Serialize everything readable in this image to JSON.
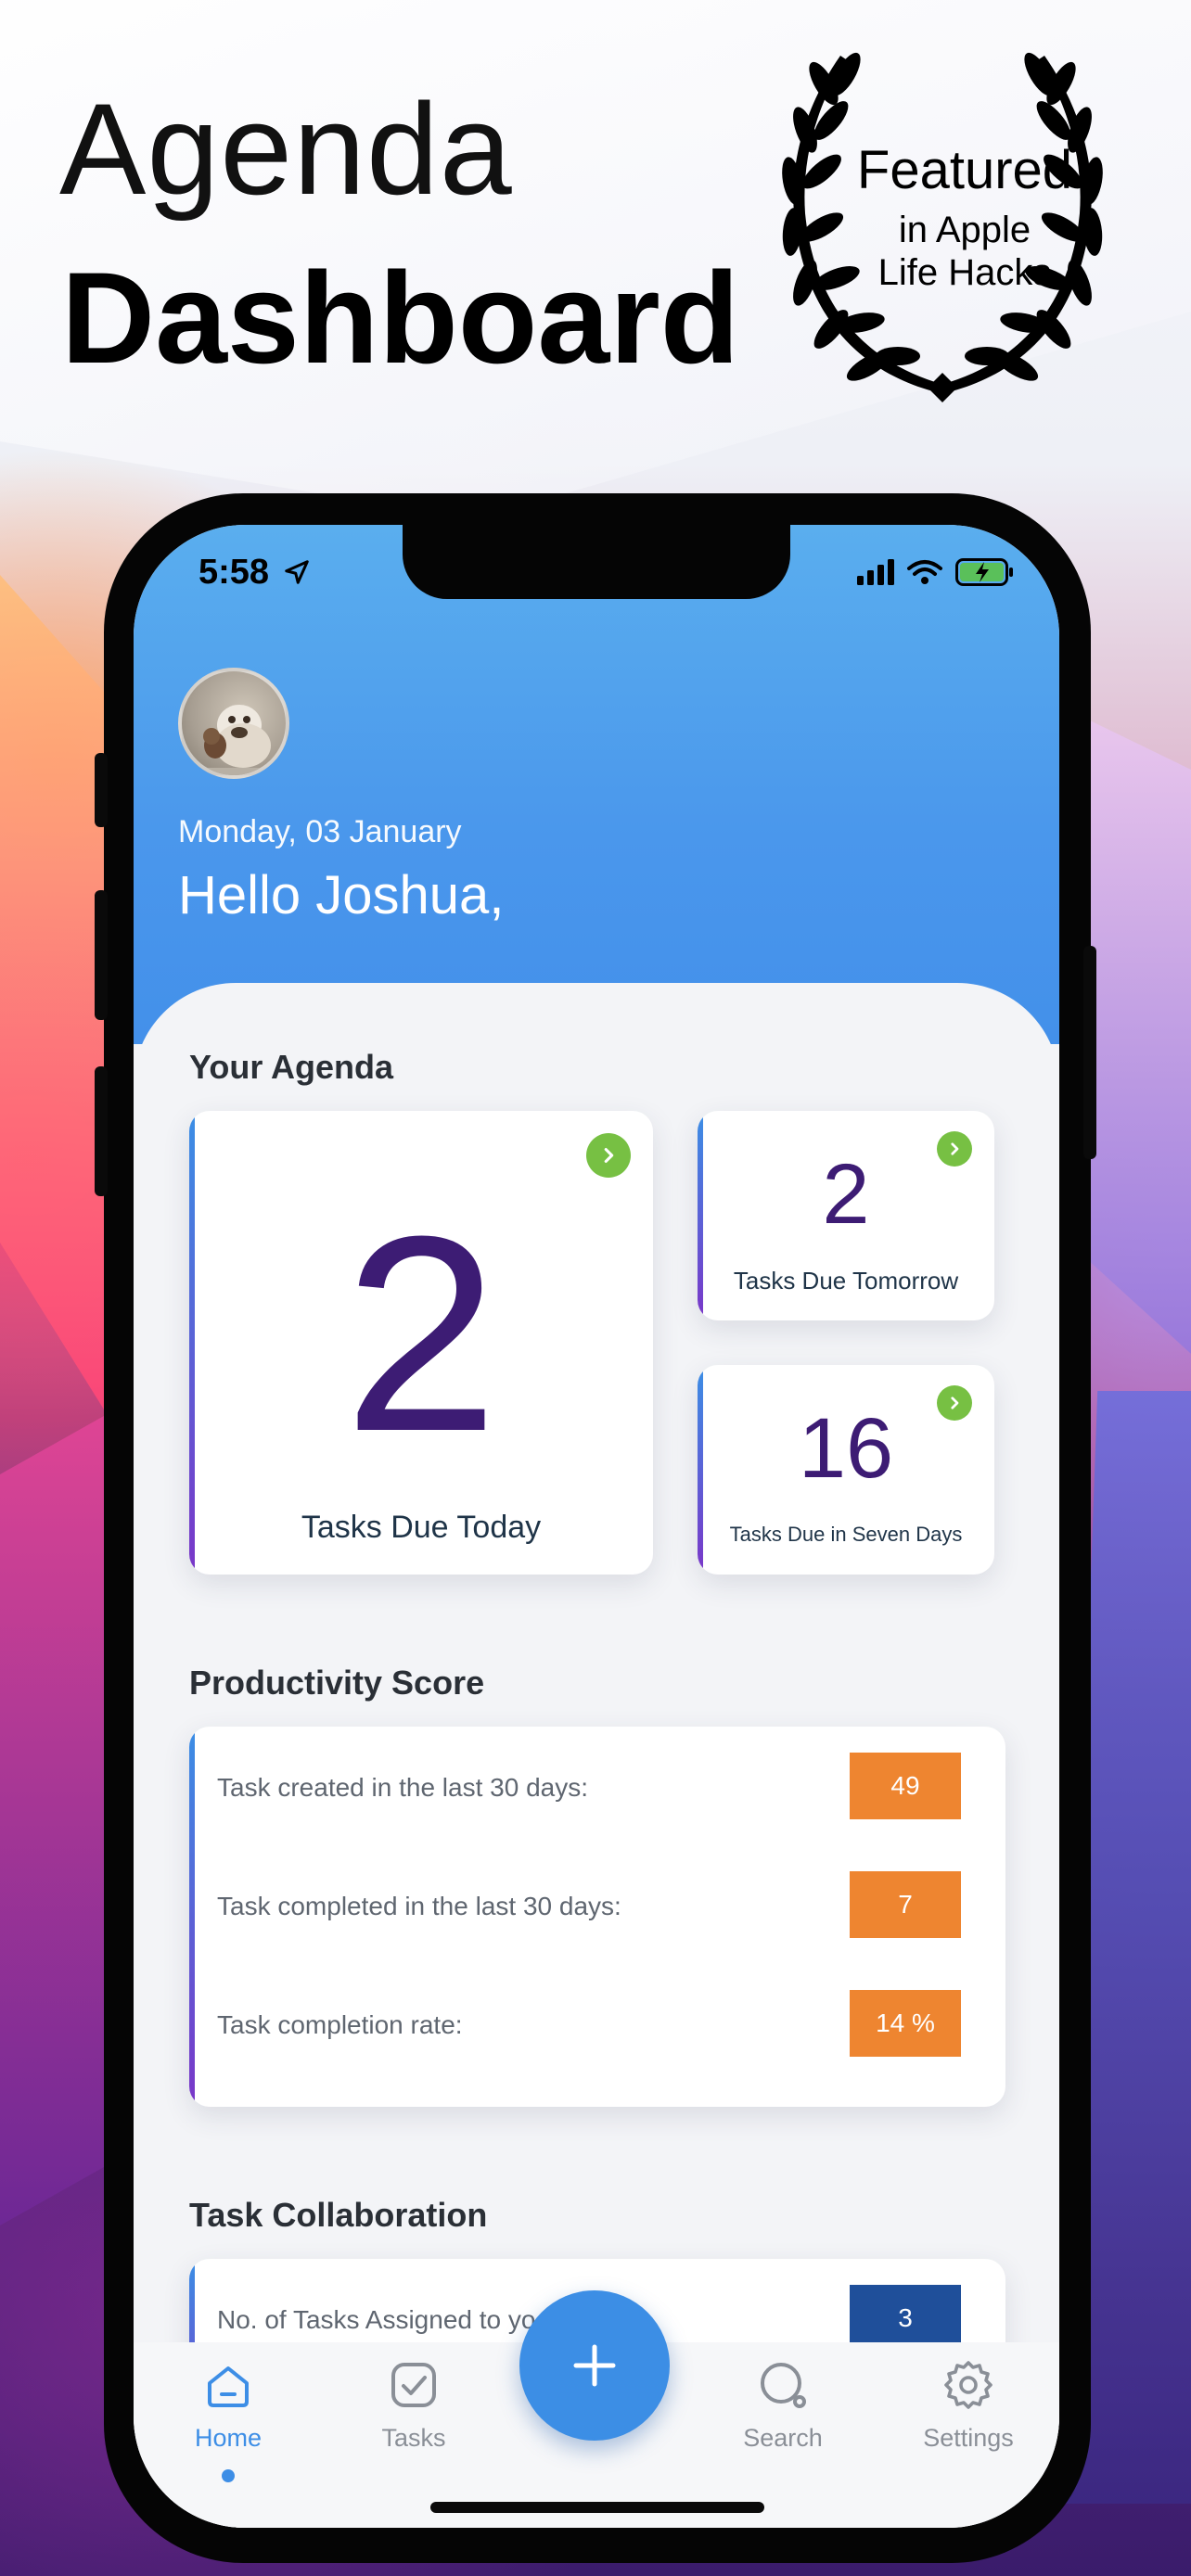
{
  "promo": {
    "title_line1": "Agenda",
    "title_line2": "Dashboard",
    "award_line1": "Featured",
    "award_line2": "in Apple",
    "award_line3": "Life Hacks"
  },
  "status_bar": {
    "time": "5:58",
    "icons": [
      "location-arrow-icon",
      "cellular-signal-icon",
      "wifi-icon",
      "battery-charging-icon"
    ]
  },
  "header": {
    "date": "Monday, 03 January",
    "greeting": "Hello Joshua,"
  },
  "agenda": {
    "title": "Your Agenda",
    "today": {
      "count": "2",
      "label": "Tasks Due Today"
    },
    "tomorrow": {
      "count": "2",
      "label": "Tasks Due Tomorrow"
    },
    "seven_days": {
      "count": "16",
      "label": "Tasks Due in Seven Days"
    }
  },
  "productivity": {
    "title": "Productivity Score",
    "rows": [
      {
        "label": "Task created in the last 30 days:",
        "value": "49"
      },
      {
        "label": "Task completed in the last 30 days:",
        "value": "7"
      },
      {
        "label": "Task completion rate:",
        "value": "14 %"
      }
    ]
  },
  "collaboration": {
    "title": "Task Collaboration",
    "rows": [
      {
        "label": "No. of Tasks Assigned to yo",
        "value": "3"
      }
    ]
  },
  "tabbar": {
    "home": "Home",
    "tasks": "Tasks",
    "search": "Search",
    "settings": "Settings",
    "fab": "+"
  },
  "colors": {
    "accent": "#3c8ee5",
    "badge_orange": "#ee8530",
    "badge_blue": "#1f4f9a",
    "number_purple": "#3d1c74",
    "go_green": "#77c043"
  }
}
